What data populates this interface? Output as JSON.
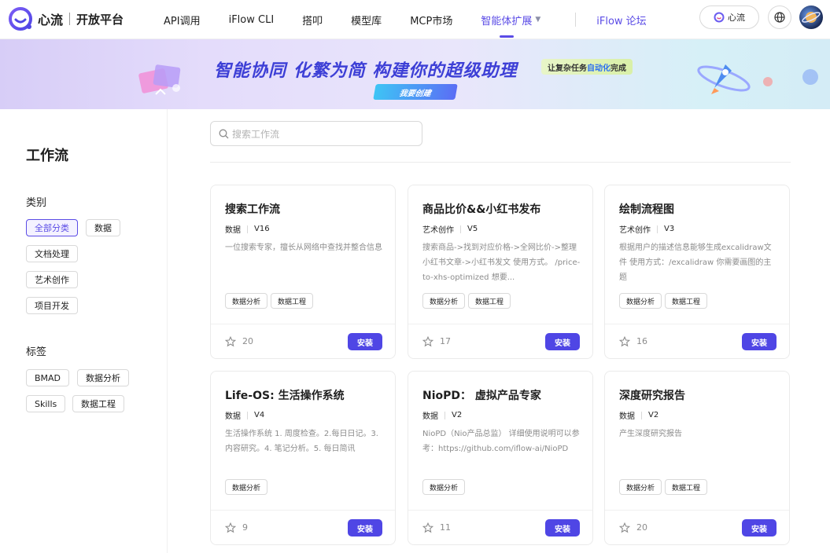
{
  "brand": {
    "name": "心流",
    "sub": "开放平台"
  },
  "nav": {
    "items": [
      "API调用",
      "iFlow CLI",
      "搭叩",
      "模型库",
      "MCP市场"
    ],
    "active": "智能体扩展",
    "forum": "iFlow 论坛",
    "xinliu_button": "心流"
  },
  "banner": {
    "title": "智能协同 化繁为简 构建你的超级助理",
    "badge_pre": "让复杂任务",
    "badge_hl": "自动化",
    "badge_post": "完成",
    "cta": "我要创建"
  },
  "sidebar": {
    "title": "工作流",
    "category_label": "类别",
    "categories": [
      "全部分类",
      "数据",
      "文档处理",
      "艺术创作",
      "项目开发"
    ],
    "active_category": "全部分类",
    "tag_label": "标签",
    "tags": [
      "BMAD",
      "数据分析",
      "Skills",
      "数据工程"
    ]
  },
  "search": {
    "placeholder": "搜索工作流"
  },
  "install_label": "安装",
  "cards": [
    {
      "title": "搜索工作流",
      "category": "数据",
      "version": "V16",
      "desc": "一位搜索专家，擅长从网络中查找并整合信息",
      "tags": [
        "数据分析",
        "数据工程"
      ],
      "stars": "20"
    },
    {
      "title": "商品比价&&小红书发布",
      "category": "艺术创作",
      "version": "V5",
      "desc": "搜索商品->找到对应价格->全网比价->整理小红书文章->小红书发文 使用方式。 /price-to-xhs-optimized 想要...",
      "tags": [
        "数据分析",
        "数据工程"
      ],
      "stars": "17"
    },
    {
      "title": "绘制流程图",
      "category": "艺术创作",
      "version": "V3",
      "desc": "根据用户的描述信息能够生成excalidraw文件 使用方式：/excalidraw 你需要画图的主题",
      "tags": [
        "数据分析",
        "数据工程"
      ],
      "stars": "16"
    },
    {
      "title": "Life-OS: 生活操作系统",
      "category": "数据",
      "version": "V4",
      "desc": "生活操作系统 1. 周度检查。2.每日日记。3. 内容研究。4. 笔记分析。5. 每日简讯",
      "tags": [
        "数据分析"
      ],
      "stars": "9"
    },
    {
      "title": "NioPD： 虚拟产品专家",
      "category": "数据",
      "version": "V2",
      "desc": "NioPD（Nio产品总监） 详细使用说明可以参考：https://github.com/iflow-ai/NioPD",
      "tags": [
        "数据分析"
      ],
      "stars": "11"
    },
    {
      "title": "深度研究报告",
      "category": "数据",
      "version": "V2",
      "desc": "产生深度研究报告",
      "tags": [
        "数据分析",
        "数据工程"
      ],
      "stars": "20"
    }
  ],
  "colors": {
    "accent": "#5b4ce6",
    "install": "#4f46e5"
  }
}
